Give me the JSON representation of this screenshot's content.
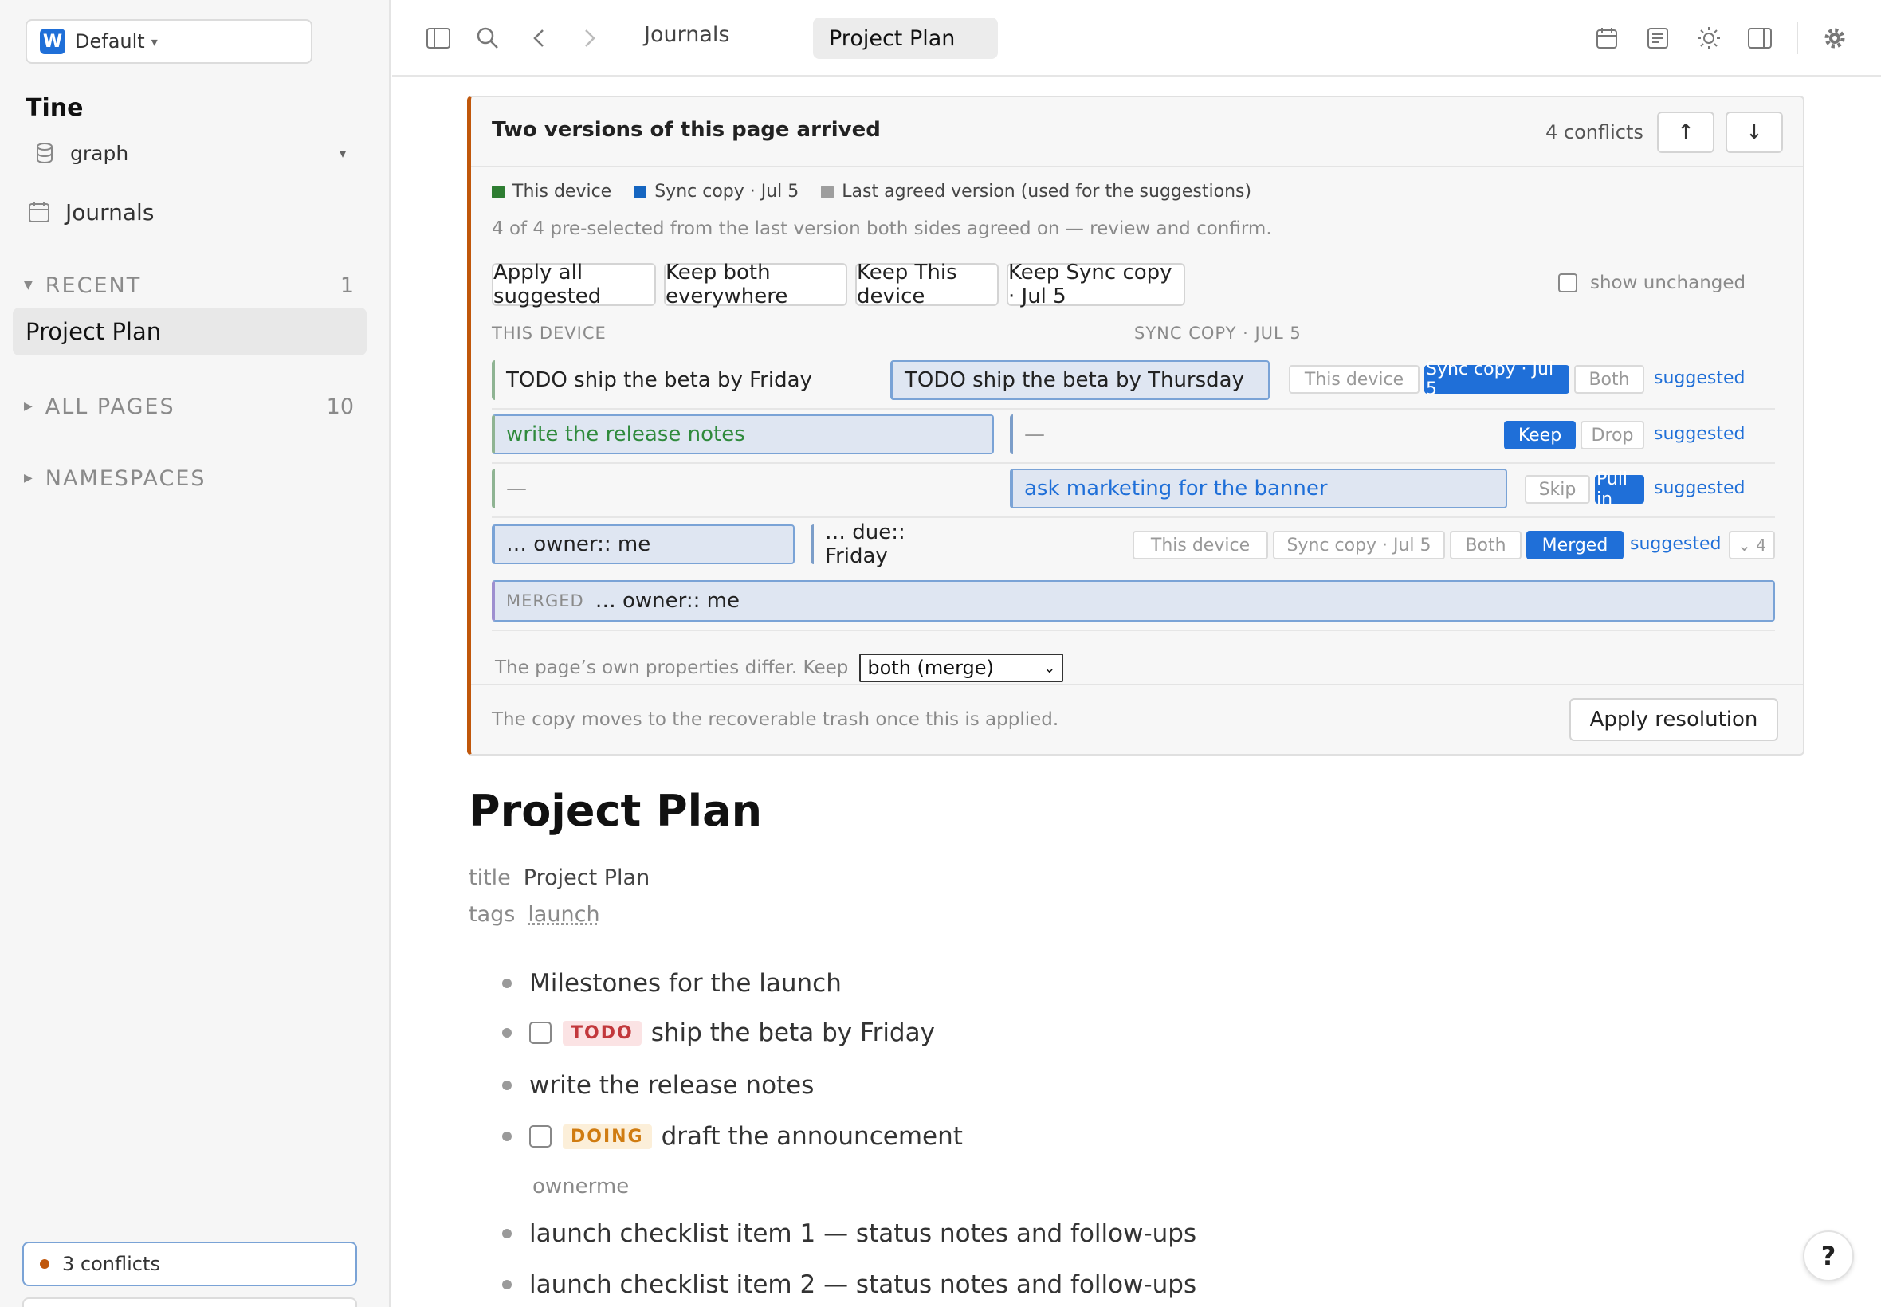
{
  "sidebar": {
    "workspace_badge": "W",
    "workspace_name": "Default",
    "app_name": "Tine",
    "graph_label": "graph",
    "journals_label": "Journals",
    "recent": {
      "label": "RECENT",
      "count": "1",
      "items": [
        "Project Plan"
      ]
    },
    "all_pages": {
      "label": "ALL PAGES",
      "count": "10"
    },
    "namespaces": {
      "label": "NAMESPACES"
    },
    "conflict_pill": "3 conflicts"
  },
  "topbar": {
    "tabs": [
      {
        "label": "Journals"
      },
      {
        "label": "Project Plan"
      }
    ],
    "icons": [
      "sidebar-toggle-icon",
      "search-icon",
      "back-icon",
      "forward-icon",
      "calendar-icon",
      "reader-icon",
      "theme-icon",
      "right-panel-icon",
      "settings-icon"
    ]
  },
  "conflict": {
    "title": "Two versions of this page arrived",
    "count": "4 conflicts",
    "legend": [
      {
        "label": "This device",
        "color": "#2e7d32"
      },
      {
        "label": "Sync copy · Jul 5",
        "color": "#1565c0"
      },
      {
        "label": "Last agreed version (used for the suggestions)",
        "color": "#9e9e9e"
      }
    ],
    "summary": "4 of 4 pre-selected from the last version both sides agreed on — review and confirm.",
    "actions": [
      "Apply all suggested",
      "Keep both everywhere",
      "Keep This device",
      "Keep Sync copy · Jul 5"
    ],
    "show_unchanged": "show unchanged",
    "col_this": "THIS DEVICE",
    "col_sync": "SYNC COPY · JUL 5",
    "rows": [
      {
        "left": "TODO ship the beta by Friday",
        "right": "TODO ship the beta by Thursday",
        "chips": [
          "This device",
          "Sync copy · Jul 5",
          "Both"
        ],
        "suggested": "suggested"
      },
      {
        "left": "write the release notes",
        "right": "—",
        "chips": [
          "Keep",
          "Drop"
        ],
        "suggested": "suggested"
      },
      {
        "left": "—",
        "right": "ask marketing for the banner",
        "chips": [
          "Skip",
          "Pull in"
        ],
        "suggested": "suggested"
      },
      {
        "left": "… owner:: me",
        "right": "… due:: Friday",
        "chips": [
          "This device",
          "Sync copy · Jul 5",
          "Both",
          "Merged"
        ],
        "suggested": "suggested",
        "expand": "⌄ 4"
      }
    ],
    "merged_tag": "MERGED",
    "merged_value": "… owner:: me",
    "props_label": "The page’s own properties differ. Keep",
    "props_select": "both (merge)",
    "foot_note": "The copy moves to the recoverable trash once this is applied.",
    "apply_label": "Apply resolution"
  },
  "page": {
    "title": "Project Plan",
    "props": [
      {
        "key": "title",
        "value": "Project Plan"
      },
      {
        "key": "tags",
        "value": "launch"
      }
    ],
    "blocks": [
      {
        "text": "Milestones for the launch"
      },
      {
        "marker": "TODO",
        "text": "ship the beta by Friday"
      },
      {
        "text": "write the release notes"
      },
      {
        "marker": "DOING",
        "text": "draft the announcement"
      },
      {
        "text": "launch checklist item 1 — status notes and follow-ups"
      },
      {
        "text": "launch checklist item 2 — status notes and follow-ups"
      }
    ],
    "sub_prop": "ownerme"
  },
  "help_label": "?"
}
